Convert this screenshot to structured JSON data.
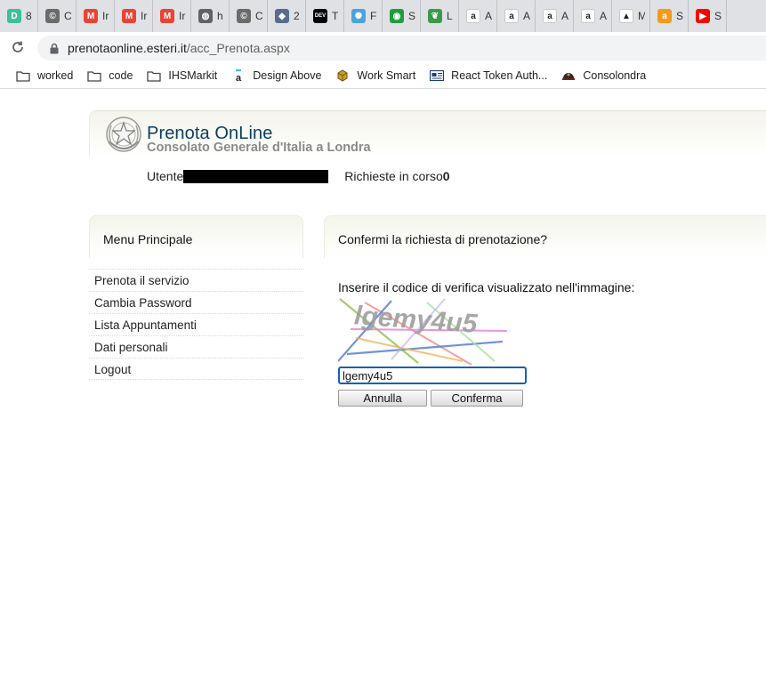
{
  "tabs": [
    {
      "fav": "D",
      "bg": "#3dbf9b",
      "icon": "green-d-icon"
    },
    {
      "fav": "©",
      "bg": "#6b6b6b",
      "icon": "copyright-icon"
    },
    {
      "fav": "M",
      "bg": "#ea4335",
      "icon": "gmail-icon"
    },
    {
      "fav": "M",
      "bg": "#ea4335",
      "icon": "gmail-icon"
    },
    {
      "fav": "M",
      "bg": "#ea4335",
      "icon": "gmail-icon"
    },
    {
      "fav": "◍",
      "bg": "#5f6368",
      "icon": "globe-icon"
    },
    {
      "fav": "©",
      "bg": "#6b6b6b",
      "icon": "copyright-icon"
    },
    {
      "fav": "◆",
      "bg": "#5a6b8c",
      "icon": "shield-icon"
    },
    {
      "fav": "DEV",
      "bg": "#000000",
      "icon": "dev-icon"
    },
    {
      "fav": "✺",
      "bg": "#4aa3df",
      "icon": "react-icon"
    },
    {
      "fav": "◉",
      "bg": "#1f9d3a",
      "icon": "green-circle-icon"
    },
    {
      "fav": "❦",
      "bg": "#3b9a4a",
      "icon": "leaf-icon"
    },
    {
      "fav": "a",
      "bg": "#ffffff",
      "icon": "amazon-icon"
    },
    {
      "fav": "a",
      "bg": "#ffffff",
      "icon": "amazon-icon"
    },
    {
      "fav": "a",
      "bg": "#ffffff",
      "icon": "amazon-icon"
    },
    {
      "fav": "a",
      "bg": "#ffffff",
      "icon": "amazon-icon"
    },
    {
      "fav": "▲",
      "bg": "#ffffff",
      "icon": "drive-icon"
    },
    {
      "fav": "a",
      "bg": "#f39a1c",
      "icon": "amazon-orange-icon"
    },
    {
      "fav": "▶",
      "bg": "#ff0000",
      "icon": "youtube-icon"
    }
  ],
  "tab_title_initials": [
    "8",
    "C",
    "Ir",
    "Ir",
    "Ir",
    "h",
    "C",
    "2",
    "T",
    "F",
    "S",
    "L",
    "A",
    "A",
    "A",
    "A",
    "M",
    "S",
    "S"
  ],
  "address": {
    "host": "prenotaonline.esteri.it",
    "path": "/acc_Prenota.aspx"
  },
  "bookmarks": [
    {
      "label": "worked",
      "icon": "folder-icon"
    },
    {
      "label": "code",
      "icon": "folder-icon"
    },
    {
      "label": "IHSMarkit",
      "icon": "folder-icon"
    },
    {
      "label": "Design Above",
      "icon": "a-logo-icon"
    },
    {
      "label": "Work Smart",
      "icon": "box-icon"
    },
    {
      "label": "React Token Auth...",
      "icon": "card-icon"
    },
    {
      "label": "Consolondra",
      "icon": "helmet-icon"
    }
  ],
  "header": {
    "title": "Prenota OnLine",
    "subtitle": "Consolato Generale d'Italia a Londra"
  },
  "user": {
    "label": "Utente",
    "requests_label": "Richieste in corso",
    "requests_count": "0"
  },
  "menu": {
    "title": "Menu Principale",
    "items": [
      "Prenota il servizio",
      "Cambia Password",
      "Lista Appuntamenti",
      "Dati personali",
      "Logout"
    ]
  },
  "main": {
    "title": "Confermi la richiesta di prenotazione?",
    "instruction": "Inserire il codice di verifica visualizzato nell'immagine:",
    "captcha_text": "lgemy4u5",
    "input_value": "lgemy4u5",
    "cancel_label": "Annulla",
    "confirm_label": "Conferma"
  }
}
